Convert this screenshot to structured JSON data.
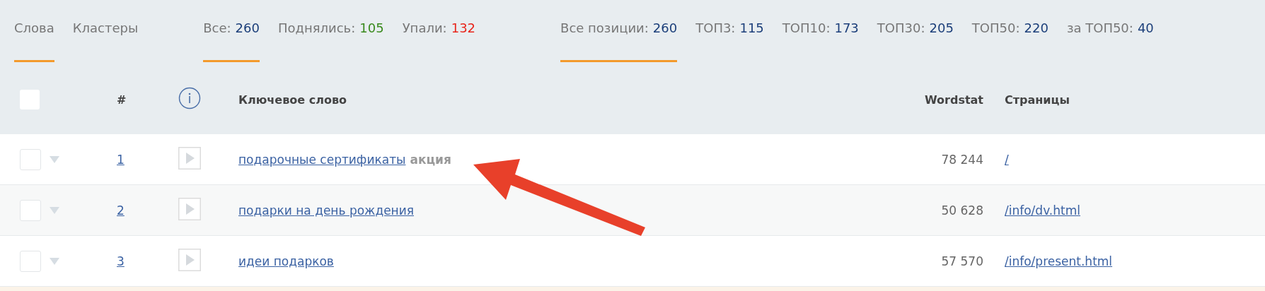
{
  "tab_groups": [
    {
      "items": [
        {
          "label": "Слова",
          "selected": true
        },
        {
          "label": "Кластеры",
          "selected": false
        }
      ]
    },
    {
      "items": [
        {
          "label": "Все:",
          "value": "260",
          "color": "#1c3f7a",
          "selected": true
        },
        {
          "label": "Поднялись:",
          "value": "105",
          "color": "#3a8a1e",
          "selected": false
        },
        {
          "label": "Упали:",
          "value": "132",
          "color": "#e8261c",
          "selected": false
        }
      ]
    },
    {
      "items": [
        {
          "label": "Все позиции:",
          "value": "260",
          "color": "#1c3f7a",
          "selected": true
        },
        {
          "label": "ТОП3:",
          "value": "115",
          "color": "#1c3f7a",
          "selected": false
        },
        {
          "label": "ТОП10:",
          "value": "173",
          "color": "#1c3f7a",
          "selected": false
        },
        {
          "label": "ТОП30:",
          "value": "205",
          "color": "#1c3f7a",
          "selected": false
        },
        {
          "label": "ТОП50:",
          "value": "220",
          "color": "#1c3f7a",
          "selected": false
        },
        {
          "label": "за ТОП50:",
          "value": "40",
          "color": "#1c3f7a",
          "selected": false
        }
      ]
    }
  ],
  "table": {
    "header_checked": false,
    "columns": [
      "#",
      "Ключевое слово",
      "Wordstat",
      "Страницы"
    ],
    "rows": [
      {
        "checked": false,
        "number": "1",
        "keyword": "подарочные сертификаты",
        "tag": "акция",
        "wordstat": "78 244",
        "page": "/"
      },
      {
        "checked": false,
        "number": "2",
        "keyword": "подарки на день рождения",
        "wordstat": "50 628",
        "page": "/info/dv.html"
      },
      {
        "checked": false,
        "number": "3",
        "keyword": "идеи подарков",
        "wordstat": "57 570",
        "page": "/info/present.html"
      }
    ]
  }
}
